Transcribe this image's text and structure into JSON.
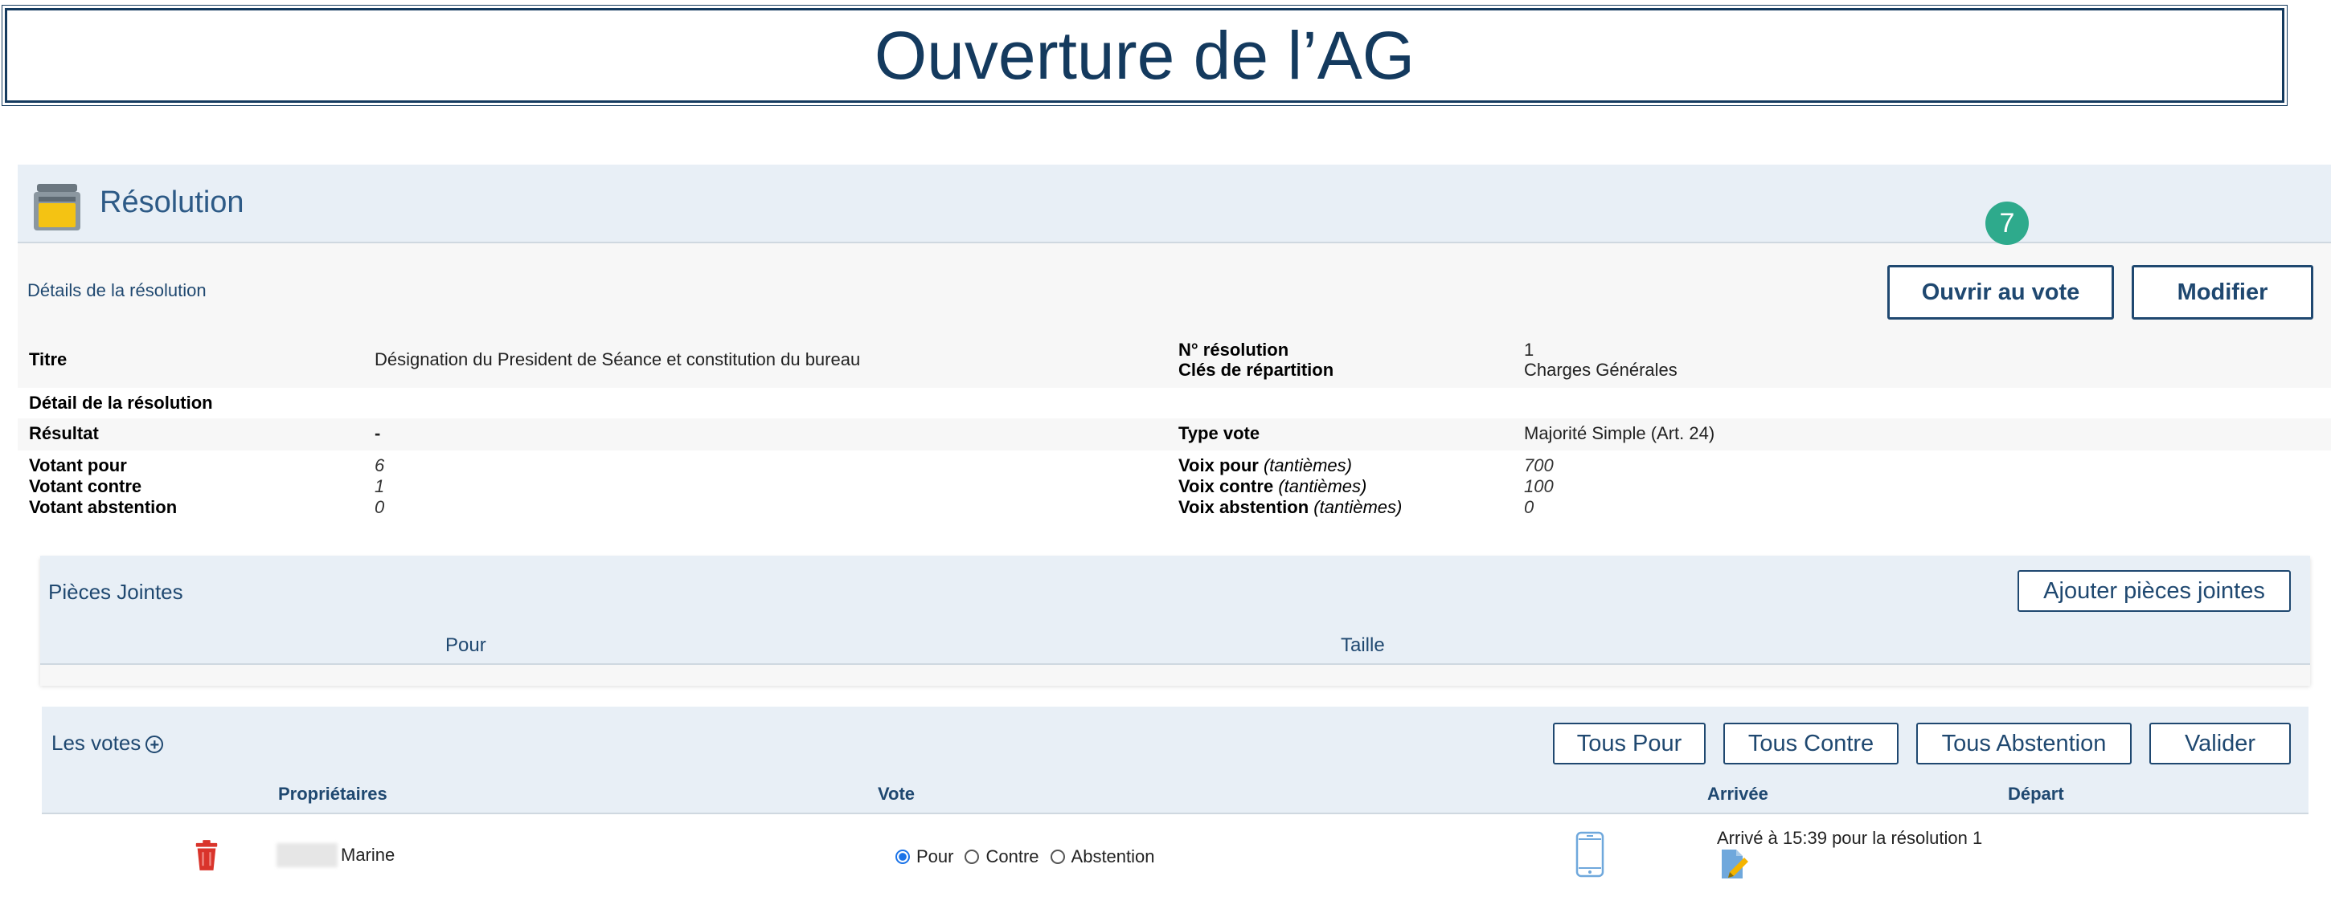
{
  "page": {
    "title": "Ouverture de l’AG"
  },
  "resolution": {
    "header_title": "Résolution",
    "step_badge": "7",
    "details_link": "Détails de la résolution",
    "buttons": {
      "open_vote": "Ouvrir au vote",
      "modify": "Modifier"
    },
    "fields": {
      "titre_label": "Titre",
      "titre_value": "Désignation du President de Séance et constitution du bureau",
      "numero_label": "N° résolution",
      "numero_value": "1",
      "cles_label": "Clés de répartition",
      "cles_value": "Charges Générales",
      "detail_label": "Détail de la résolution",
      "resultat_label": "Résultat",
      "resultat_value": "-",
      "type_vote_label": "Type vote",
      "type_vote_value": "Majorité Simple (Art. 24)",
      "votant_pour_label": "Votant pour",
      "votant_pour_value": "6",
      "votant_contre_label": "Votant contre",
      "votant_contre_value": "1",
      "votant_abstention_label": "Votant abstention",
      "votant_abstention_value": "0",
      "voix_pour_label": "Voix pour",
      "voix_contre_label": "Voix contre",
      "voix_abstention_label": "Voix abstention",
      "tantiemes_label": "(tantièmes)",
      "voix_pour_value": "700",
      "voix_contre_value": "100",
      "voix_abstention_value": "0"
    }
  },
  "attachments": {
    "title": "Pièces Jointes",
    "add_button": "Ajouter pièces jointes",
    "columns": [
      "Pour",
      "Taille"
    ]
  },
  "votes": {
    "title": "Les votes",
    "plus": "+",
    "buttons": [
      "Tous Pour",
      "Tous Contre",
      "Tous Abstention",
      "Valider"
    ],
    "columns": {
      "owners": "Propriétaires",
      "vote": "Vote",
      "arrival": "Arrivée",
      "departure": "Départ"
    },
    "rows": [
      {
        "owner": "Marine",
        "options": [
          "Pour",
          "Contre",
          "Abstention"
        ],
        "selected": "Pour",
        "arrival": "Arrivé à 15:39 pour la résolution 1"
      }
    ]
  },
  "icons": {
    "resolution": "ballot-box-icon",
    "delete": "trash-icon",
    "device": "smartphone-icon",
    "signature": "document-sign-icon"
  },
  "colors": {
    "primary": "#1f4870",
    "accent": "#2eaa8c",
    "panel": "#e8eff6",
    "danger": "#d9342b",
    "device": "#6fa8dc"
  }
}
